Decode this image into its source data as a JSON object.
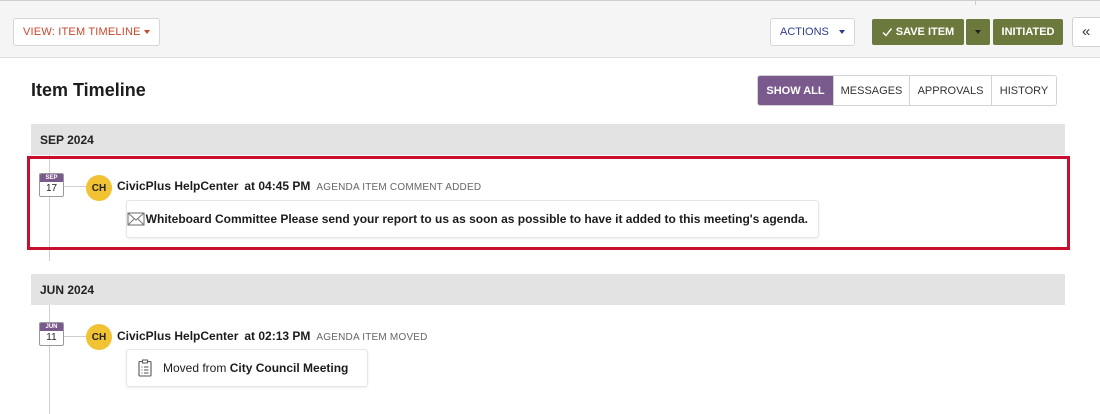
{
  "toolbar": {
    "view_label": "VIEW: ITEM TIMELINE",
    "actions_label": "ACTIONS",
    "save_label": "SAVE ITEM",
    "status_label": "INITIATED",
    "collapse_label": "«"
  },
  "page": {
    "title": "Item Timeline"
  },
  "filters": [
    {
      "label": "SHOW ALL",
      "active": true
    },
    {
      "label": "MESSAGES",
      "active": false
    },
    {
      "label": "APPROVALS",
      "active": false
    },
    {
      "label": "HISTORY",
      "active": false
    }
  ],
  "months": [
    {
      "label": "SEP 2024",
      "entry": {
        "date_month": "SEP",
        "date_day": "17",
        "avatar_initials": "CH",
        "author": "CivicPlus HelpCenter",
        "time": "at 04:45 PM",
        "type": "AGENDA ITEM COMMENT ADDED",
        "icon": "envelope-icon",
        "body": "Whiteboard Committee Please send your report to us as soon as possible to have it added to this meeting's agenda."
      }
    },
    {
      "label": "JUN 2024",
      "entry": {
        "date_month": "JUN",
        "date_day": "11",
        "avatar_initials": "CH",
        "author": "CivicPlus HelpCenter",
        "time": "at 02:13 PM",
        "type": "AGENDA ITEM MOVED",
        "icon": "clipboard-icon",
        "body_prefix": "Moved from",
        "body_target": "City Council Meeting"
      }
    }
  ],
  "colors": {
    "accent_purple": "#7a5a8c",
    "save_green": "#6b7a3c",
    "avatar_yellow": "#f1c232",
    "highlight_red": "#c8102e",
    "view_orange": "#c8472b",
    "actions_blue": "#2d3d8f"
  }
}
